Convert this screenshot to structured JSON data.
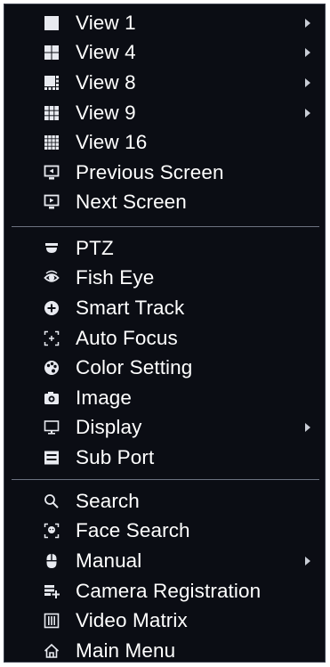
{
  "colors": {
    "menu_background": "#0b0d14",
    "text": "#ffffff",
    "icon": "#e8eaf0",
    "divider": "#6c7280"
  },
  "view_section": [
    {
      "label": "View 1",
      "icon": "single-view-icon",
      "submenu": true
    },
    {
      "label": "View 4",
      "icon": "quad-view-icon",
      "submenu": true
    },
    {
      "label": "View 8",
      "icon": "eight-view-icon",
      "submenu": true
    },
    {
      "label": "View 9",
      "icon": "nine-view-icon",
      "submenu": true
    },
    {
      "label": "View 16",
      "icon": "sixteen-view-icon",
      "submenu": false
    },
    {
      "label": "Previous Screen",
      "icon": "previous-screen-icon",
      "submenu": false
    },
    {
      "label": "Next Screen",
      "icon": "next-screen-icon",
      "submenu": false
    }
  ],
  "control_section": [
    {
      "label": "PTZ",
      "icon": "ptz-camera-icon",
      "submenu": false
    },
    {
      "label": "Fish Eye",
      "icon": "fish-eye-icon",
      "submenu": false
    },
    {
      "label": "Smart Track",
      "icon": "smart-track-icon",
      "submenu": false
    },
    {
      "label": "Auto Focus",
      "icon": "auto-focus-icon",
      "submenu": false
    },
    {
      "label": "Color Setting",
      "icon": "color-palette-icon",
      "submenu": false
    },
    {
      "label": "Image",
      "icon": "camera-icon",
      "submenu": false
    },
    {
      "label": "Display",
      "icon": "monitor-icon",
      "submenu": true
    },
    {
      "label": "Sub Port",
      "icon": "sub-port-icon",
      "submenu": false
    }
  ],
  "tools_section": [
    {
      "label": "Search",
      "icon": "search-icon",
      "submenu": false
    },
    {
      "label": "Face Search",
      "icon": "face-search-icon",
      "submenu": false
    },
    {
      "label": "Manual",
      "icon": "mouse-icon",
      "submenu": true
    },
    {
      "label": "Camera Registration",
      "icon": "camera-registration-icon",
      "submenu": false
    },
    {
      "label": "Video Matrix",
      "icon": "video-matrix-icon",
      "submenu": false
    },
    {
      "label": "Main Menu",
      "icon": "home-icon",
      "submenu": false
    }
  ]
}
